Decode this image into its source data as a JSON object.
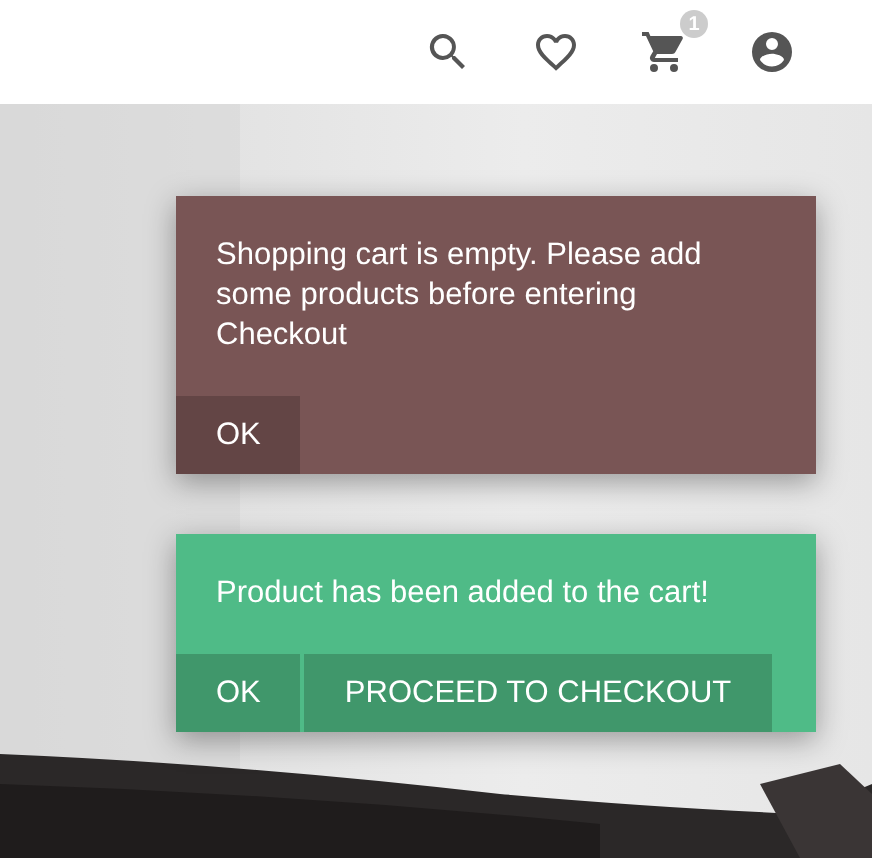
{
  "header": {
    "cart_count": "1"
  },
  "notifications": [
    {
      "kind": "error",
      "message": "Shopping cart is empty. Please add some products before entering Checkout",
      "actions": [
        "OK"
      ]
    },
    {
      "kind": "success",
      "message": "Product has been added to the cart!",
      "actions": [
        "OK",
        "PROCEED TO CHECKOUT"
      ]
    }
  ]
}
